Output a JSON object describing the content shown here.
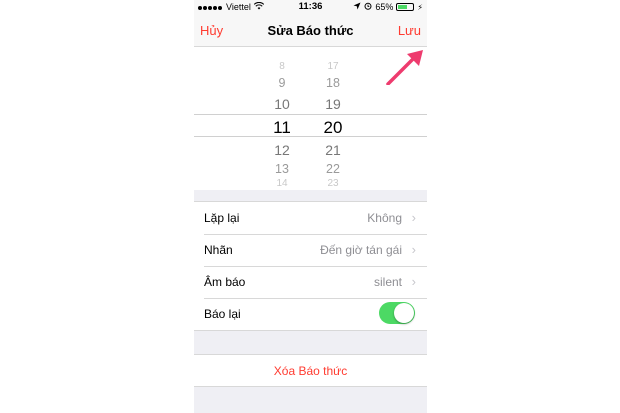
{
  "status_bar": {
    "carrier": "Viettel",
    "time": "11:36",
    "battery": "65%",
    "battery_level": 0.65
  },
  "nav": {
    "cancel_label": "Hủy",
    "title": "Sửa Báo thức",
    "save_label": "Lưu"
  },
  "picker": {
    "hours": [
      "8",
      "9",
      "10",
      "11",
      "12",
      "13",
      "14"
    ],
    "minutes": [
      "17",
      "18",
      "19",
      "20",
      "21",
      "22",
      "23"
    ],
    "selected_hour": "11",
    "selected_minute": "20"
  },
  "settings": {
    "repeat": {
      "label": "Lặp lại",
      "value": "Không"
    },
    "label": {
      "label": "Nhãn",
      "value": "Đến giờ tán gái"
    },
    "sound": {
      "label": "Âm báo",
      "value": "silent"
    },
    "snooze": {
      "label": "Báo lại",
      "enabled": true
    }
  },
  "delete_label": "Xóa Báo thức",
  "colors": {
    "accent": "#ff3b30",
    "toggle_on": "#4cd964",
    "annotation_arrow": "#ee3b6e"
  }
}
